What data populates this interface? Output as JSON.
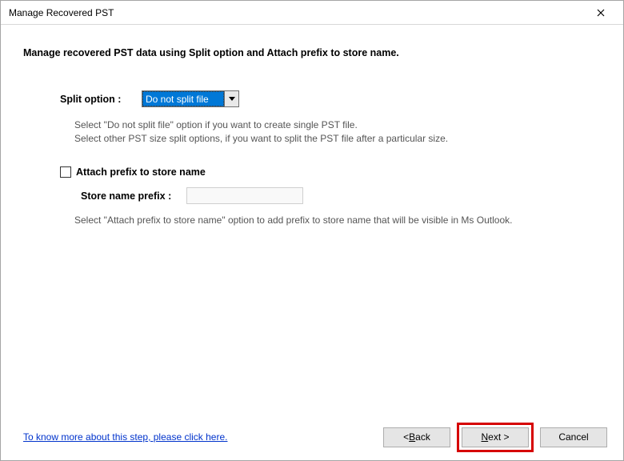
{
  "titlebar": {
    "title": "Manage Recovered PST"
  },
  "heading": "Manage recovered PST data using Split option and Attach prefix to store name.",
  "split": {
    "label": "Split option :",
    "selected": "Do not split file",
    "help1": "Select \"Do not split file\" option if you want to create single PST file.",
    "help2": "Select other PST size split options, if you want to split the PST file after a particular size."
  },
  "prefix": {
    "check_label": "Attach prefix to store name",
    "input_label": "Store name prefix :",
    "value": "",
    "help": "Select \"Attach prefix to store name\" option to add prefix to store name that will be visible in Ms Outlook."
  },
  "footer": {
    "link": "To know more about this step, please click here.",
    "back": "ack",
    "next": "ext >",
    "cancel": "Cancel"
  }
}
